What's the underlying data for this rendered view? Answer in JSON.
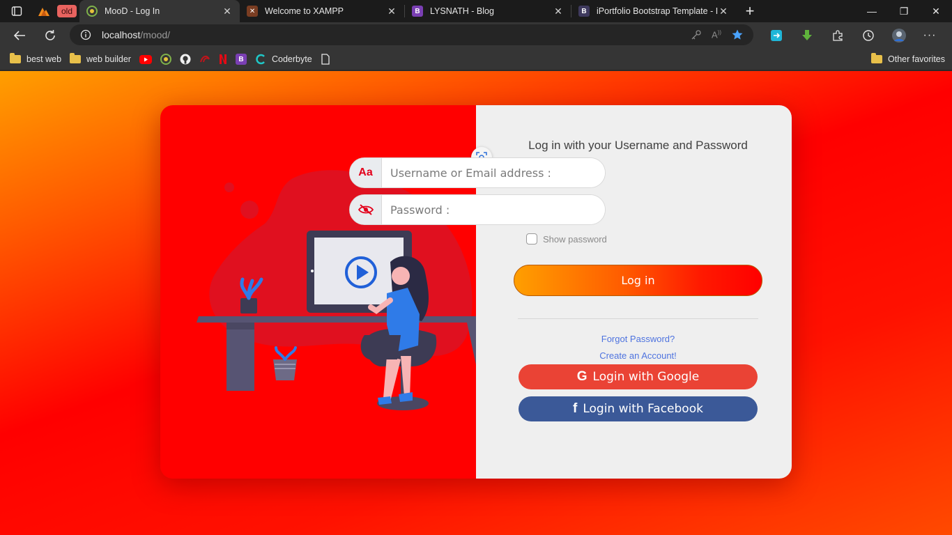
{
  "browser": {
    "group_chip": "old",
    "tabs": [
      {
        "title": "MooD - Log In",
        "active": true
      },
      {
        "title": "Welcome to XAMPP",
        "active": false
      },
      {
        "title": "LYSNATH - Blog",
        "active": false
      },
      {
        "title": "iPortfolio Bootstrap Template - Ir",
        "active": false
      }
    ],
    "url_host": "localhost",
    "url_path": "/mood/",
    "bookmarks": [
      {
        "label": "best web",
        "icon": "folder-icon"
      },
      {
        "label": "web builder",
        "icon": "folder-icon"
      },
      {
        "label": "",
        "icon": "youtube-icon"
      },
      {
        "label": "",
        "icon": "mood-logo-icon"
      },
      {
        "label": "",
        "icon": "github-icon"
      },
      {
        "label": "",
        "icon": "red-swirl-icon"
      },
      {
        "label": "",
        "icon": "netflix-icon"
      },
      {
        "label": "",
        "icon": "bootstrap-icon"
      },
      {
        "label": "Coderbyte",
        "icon": "coderbyte-icon"
      },
      {
        "label": "",
        "icon": "page-icon"
      }
    ],
    "other_favorites": "Other favorites"
  },
  "login": {
    "heading": "Log in with your Username and Password",
    "username_addon": "Aa",
    "username_placeholder": "Username or Email address :",
    "password_placeholder": "Password :",
    "show_password": "Show password",
    "login_button": "Log in",
    "forgot_password": "Forgot Password?",
    "create_account": "Create an Account!",
    "google_button": "Login with Google",
    "facebook_button": "Login with Facebook",
    "google_icon_char": "G",
    "facebook_icon_char": "f"
  },
  "colors": {
    "card_left": "#ff0000",
    "card_right": "#efefef",
    "google": "#ea4335",
    "facebook": "#3b5998",
    "link": "#4e73df"
  }
}
